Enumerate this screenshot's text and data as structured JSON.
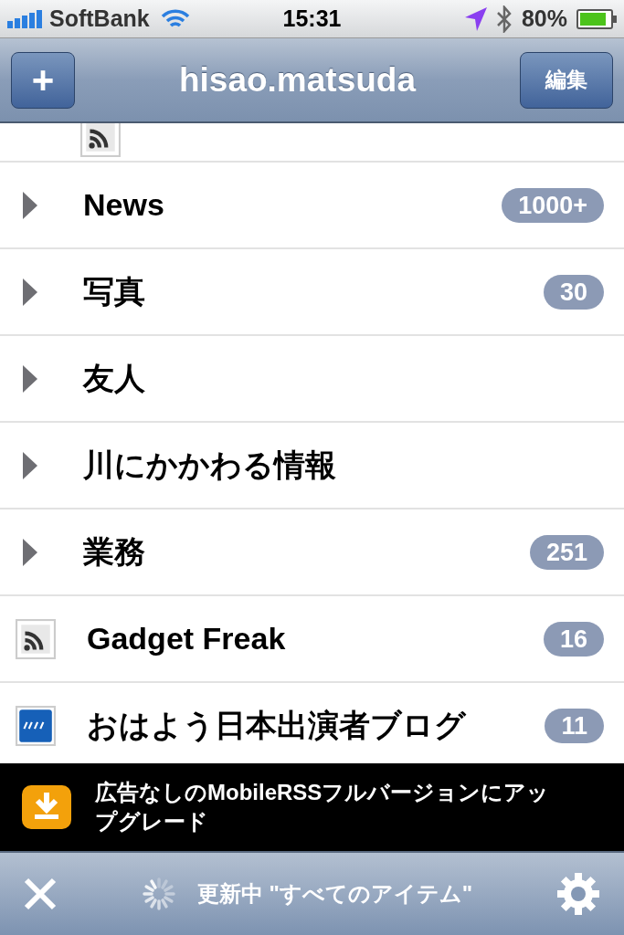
{
  "status_bar": {
    "carrier": "SoftBank",
    "time": "15:31",
    "battery": "80%"
  },
  "nav_bar": {
    "add_button": "+",
    "title": "hisao.matsuda",
    "edit_button": "編集"
  },
  "partial_row": {
    "kind": "rss"
  },
  "items": [
    {
      "kind": "folder",
      "label": "News",
      "count": "1000+"
    },
    {
      "kind": "folder",
      "label": "写真",
      "count": "30"
    },
    {
      "kind": "folder",
      "label": "友人"
    },
    {
      "kind": "folder",
      "label": "川にかかわる情報"
    },
    {
      "kind": "folder",
      "label": "業務",
      "count": "251"
    },
    {
      "kind": "rss",
      "label": "Gadget Freak",
      "count": "16"
    },
    {
      "kind": "logo",
      "label": "おはよう日本出演者ブログ",
      "count": "11"
    }
  ],
  "ad_banner": {
    "text": "広告なしのMobileRSSフルバージョンにアップグレード"
  },
  "toolbar": {
    "status": "更新中 \"すべてのアイテム\""
  }
}
